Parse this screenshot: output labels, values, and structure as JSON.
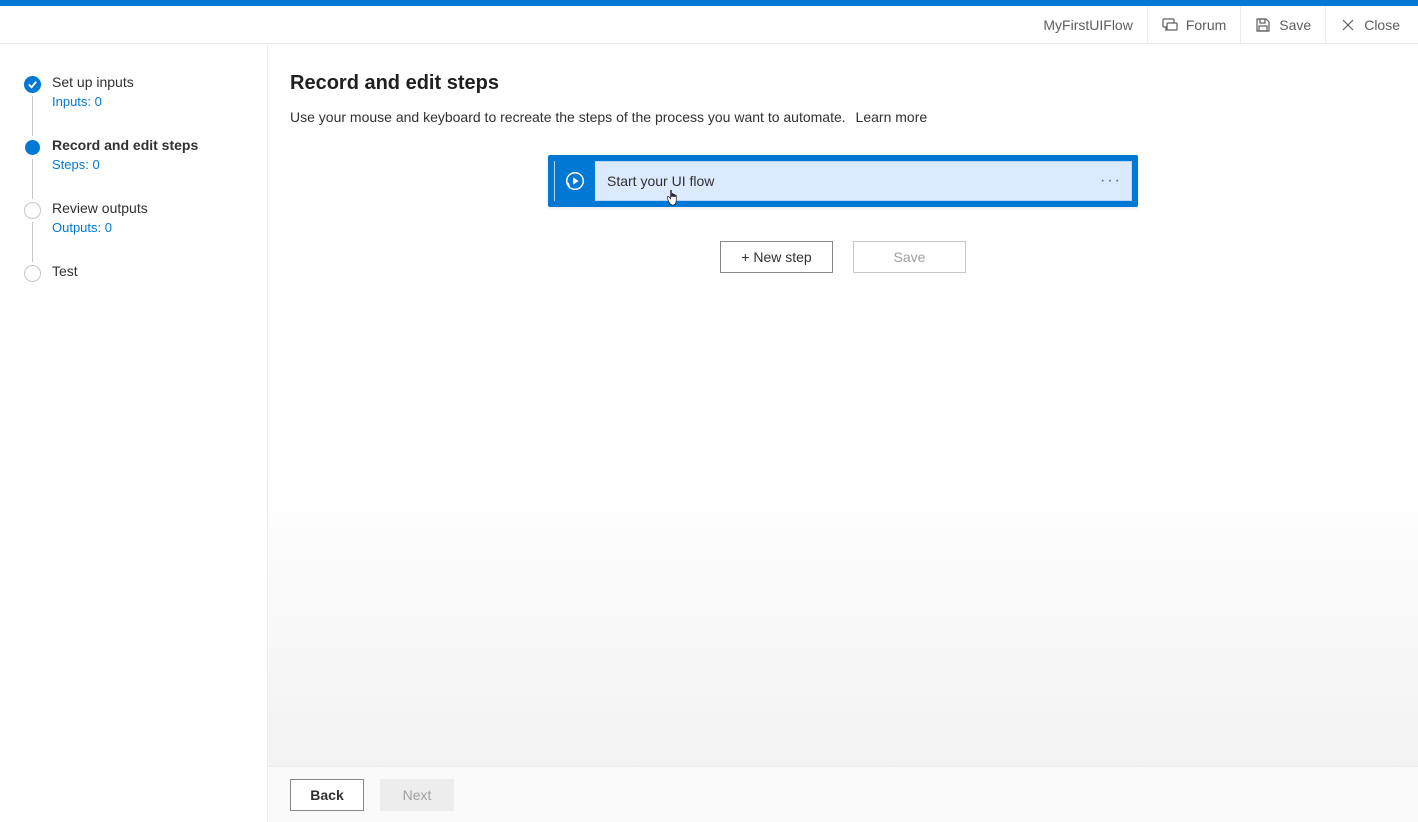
{
  "header": {
    "flow_name": "MyFirstUIFlow",
    "forum": "Forum",
    "save": "Save",
    "close": "Close"
  },
  "sidebar": {
    "steps": [
      {
        "title": "Set up inputs",
        "sub": "Inputs: 0",
        "state": "done"
      },
      {
        "title": "Record and edit steps",
        "sub": "Steps: 0",
        "state": "current"
      },
      {
        "title": "Review outputs",
        "sub": "Outputs: 0",
        "state": "pending"
      },
      {
        "title": "Test",
        "sub": "",
        "state": "pending"
      }
    ]
  },
  "page": {
    "title": "Record and edit steps",
    "description": "Use your mouse and keyboard to recreate the steps of the process you want to automate.",
    "learn_more": "Learn more"
  },
  "card": {
    "label": "Start your UI flow",
    "menu_glyph": "···",
    "icon": "play-record-icon"
  },
  "actions": {
    "new_step": "+ New step",
    "save": "Save"
  },
  "footer": {
    "back": "Back",
    "next": "Next"
  },
  "colors": {
    "accent": "#0078d4"
  }
}
